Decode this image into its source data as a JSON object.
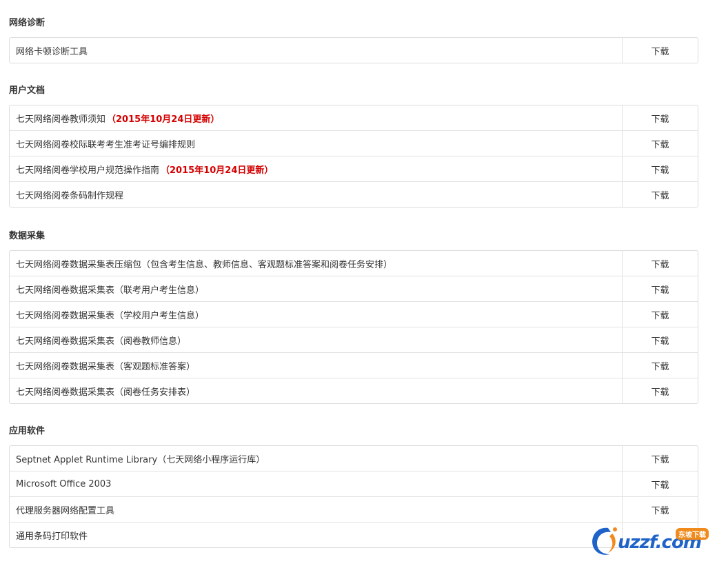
{
  "download_label": "下载",
  "sections": [
    {
      "title": "网络诊断",
      "rows": [
        {
          "name": "网络卡顿诊断工具",
          "note": "",
          "download": "下载"
        }
      ]
    },
    {
      "title": "用户文档",
      "rows": [
        {
          "name": "七天网络阅卷教师须知",
          "note": "（2015年10月24日更新）",
          "download": "下载"
        },
        {
          "name": "七天网络阅卷校际联考考生准考证号编排规则",
          "note": "",
          "download": "下载"
        },
        {
          "name": "七天网络阅卷学校用户规范操作指南",
          "note": "（2015年10月24日更新）",
          "download": "下载"
        },
        {
          "name": "七天网络阅卷条码制作规程",
          "note": "",
          "download": "下载"
        }
      ]
    },
    {
      "title": "数据采集",
      "rows": [
        {
          "name": "七天网络阅卷数据采集表压缩包（包含考生信息、教师信息、客观题标准答案和阅卷任务安排）",
          "note": "",
          "download": "下载"
        },
        {
          "name": "七天网络阅卷数据采集表（联考用户考生信息）",
          "note": "",
          "download": "下载"
        },
        {
          "name": "七天网络阅卷数据采集表（学校用户考生信息）",
          "note": "",
          "download": "下载"
        },
        {
          "name": "七天网络阅卷数据采集表（阅卷教师信息）",
          "note": "",
          "download": "下载"
        },
        {
          "name": "七天网络阅卷数据采集表（客观题标准答案）",
          "note": "",
          "download": "下载"
        },
        {
          "name": "七天网络阅卷数据采集表（阅卷任务安排表）",
          "note": "",
          "download": "下载"
        }
      ]
    },
    {
      "title": "应用软件",
      "rows": [
        {
          "name": "Septnet Applet Runtime Library（七天网络小程序运行库）",
          "note": "",
          "download": "下载"
        },
        {
          "name": "Microsoft Office 2003",
          "note": "",
          "download": "下载"
        },
        {
          "name": "代理服务器网络配置工具",
          "note": "",
          "download": "下载"
        },
        {
          "name": "通用条码打印软件",
          "note": "",
          "download": ""
        }
      ]
    }
  ],
  "watermark": {
    "text": "uzzf.com",
    "badge": "东坡下载"
  }
}
